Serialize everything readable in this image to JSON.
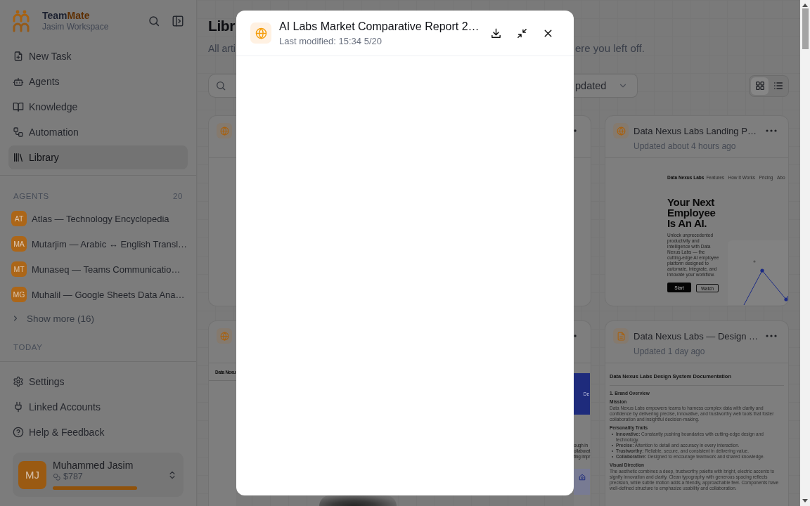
{
  "sidebar": {
    "brand": {
      "name_start": "Team",
      "name_end": "Mate",
      "workspace": "Jasim Workspace"
    },
    "nav": [
      {
        "label": "New Task",
        "selected": false
      },
      {
        "label": "Agents",
        "selected": false
      },
      {
        "label": "Knowledge",
        "selected": false
      },
      {
        "label": "Automation",
        "selected": false
      },
      {
        "label": "Library",
        "selected": true
      }
    ],
    "agents": {
      "heading": "AGENTS",
      "count": "20",
      "items": [
        {
          "initials": "AT",
          "name": "Atlas — Technology Encyclopedia"
        },
        {
          "initials": "MA",
          "name": "Mutarjim — Arabic ↔ English Transl…"
        },
        {
          "initials": "MT",
          "name": "Munaseq — Teams Communicatio…"
        },
        {
          "initials": "MG",
          "name": "Muhalil — Google Sheets Data Ana…"
        }
      ],
      "show_more": "Show more (16)"
    },
    "today_heading": "TODAY",
    "footer_nav": [
      {
        "label": "Settings"
      },
      {
        "label": "Linked Accounts"
      },
      {
        "label": "Help & Feedback"
      }
    ],
    "user": {
      "initials": "MJ",
      "name": "Muhammed Jasim",
      "credits": "$787"
    }
  },
  "main": {
    "title": "Libr",
    "subtitle_start": "All arti",
    "subtitle_end": "ere you left off.",
    "sort": "pdated",
    "view_toggle": [
      {
        "selected": true
      },
      {
        "selected": false
      }
    ],
    "left_cards": [
      {
        "kind": "website"
      },
      {
        "kind": "website",
        "preview_title": "Data Nexu"
      }
    ],
    "middle_cards": [
      {
        "kind": "blank"
      },
      {
        "kind": "article",
        "banner_text": "De",
        "excerpt_lines": [
          "ough in",
          "ollaborat",
          "ting impr"
        ]
      }
    ],
    "right_cards": [
      {
        "kind": "website",
        "title": "Data Nexus Labs Landing P…",
        "updated": "Updated about 4 hours ago",
        "preview": {
          "brand": "Data Nexus Labs",
          "nav": [
            "Features",
            "How It Works",
            "Pricing",
            "Abo"
          ],
          "headline": "Your Next Employee Is An AI.",
          "body": "Unlock unprecedented productivity and intelligence with Data Nexus Labs — the cutting-edge AI employee platform designed to automate, integrate, and innovate your workflow.",
          "buttons": [
            "Start",
            "Watch"
          ]
        }
      },
      {
        "kind": "document",
        "title": "Data Nexus Labs — Design …",
        "updated": "Updated 1 day ago",
        "preview": {
          "heading": "Data Nexus Labs Design System Documentation",
          "section": "1. Brand Overview",
          "blocks": [
            {
              "kind": "subheading",
              "text": "Mission"
            },
            {
              "kind": "paragraph",
              "text": "Data Nexus Labs empowers teams to harness complex data with clarity and confidence by delivering precise, innovative, and trustworthy web tools that foster collaboration and insightful decision-making."
            },
            {
              "kind": "subheading",
              "text": "Personality Traits"
            },
            {
              "kind": "bullets",
              "items": [
                "**Innovative:** Constantly pushing boundaries with cutting-edge design and technology.",
                "**Precise:** Attention to detail and accuracy in every interaction.",
                "**Trustworthy:** Reliable, secure, and consistent in delivering value.",
                "**Collaborative:** Designed to encourage teamwork and shared knowledge."
              ]
            },
            {
              "kind": "subheading",
              "text": "Visual Direction"
            },
            {
              "kind": "paragraph",
              "text": "The aesthetic combines a deep, trustworthy palette with bright, electric accents to signify innovation and clarity. Clean typography with generous spacing reflects precision, while subtle motion adds a friendly, approachable feel. Components have well-defined structure to emphasize usability and collaboration."
            }
          ]
        }
      }
    ]
  },
  "modal": {
    "title": "AI Labs Market Comparative Report 2…",
    "subtitle": "Last modified: 15:34 5/20"
  }
}
